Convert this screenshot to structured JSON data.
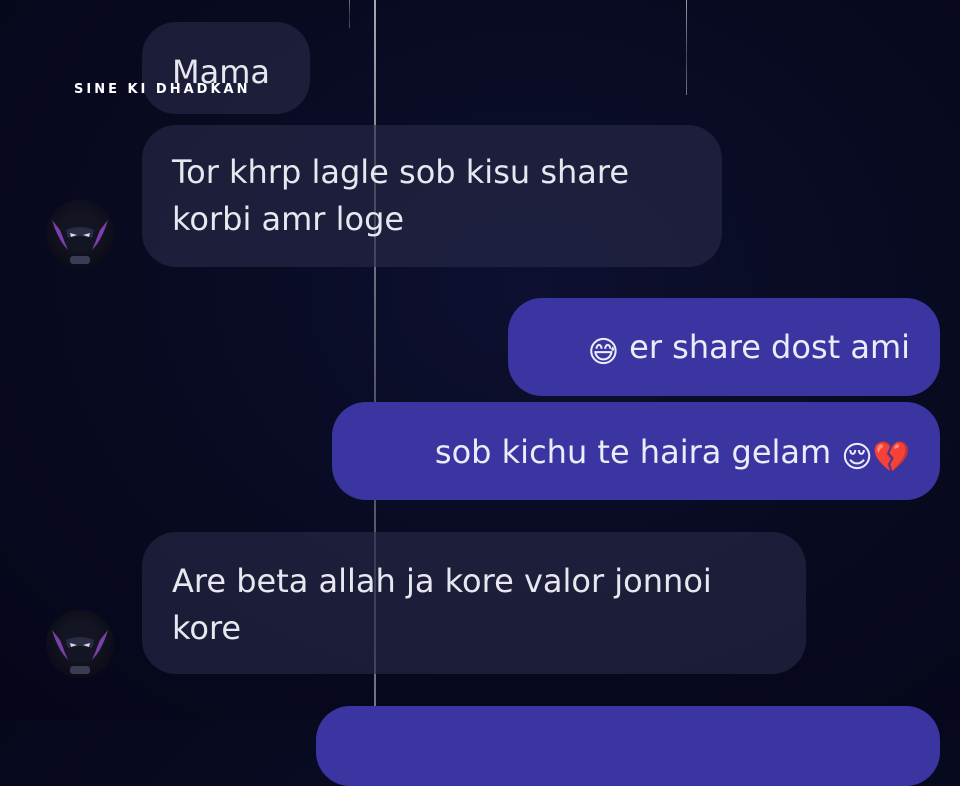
{
  "watermark": "SINE KI DHADKAN",
  "sender": {
    "name": "Mama"
  },
  "messages": [
    {
      "direction": "incoming",
      "text": "Tor khrp lagle sob kisu share korbi amr loge"
    },
    {
      "direction": "outgoing",
      "emoji_before": "😅",
      "text": "er share dost ami"
    },
    {
      "direction": "outgoing",
      "text": "sob kichu te haira gelam",
      "emoji_after": "😌💔"
    },
    {
      "direction": "incoming",
      "text": "Are beta allah ja kore valor jonnoi kore"
    }
  ],
  "colors": {
    "background": "#080a20",
    "incoming_bubble": "#282a48",
    "outgoing_bubble": "#3b35a1",
    "avatar_accent": "#7c3fa8"
  },
  "icons": {
    "avatar": "masked-hero-avatar-icon"
  }
}
